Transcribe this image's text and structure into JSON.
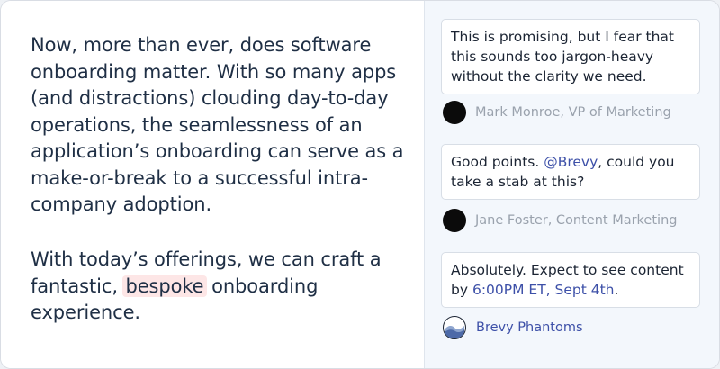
{
  "document": {
    "paragraph1": "Now, more than ever, does software onboarding matter. With so many apps (and distractions) clouding day-to-day operations, the seamlessness of an application’s onboarding can serve as a make-or-break to a successful intra-company adoption.",
    "paragraph2_before": "With today’s offerings, we can craft a fantastic, ",
    "paragraph2_highlight": "bespoke",
    "paragraph2_after": " onboarding experience."
  },
  "comments": [
    {
      "text": "This is promising, but I fear that this sounds too jargon-heavy without the clarity we need.",
      "author": "Mark Monroe, VP of Marketing"
    },
    {
      "text_before": "Good points. ",
      "mention": "@Brevy",
      "text_after": ", could you take a stab at this?",
      "author": "Jane Foster, Content Marketing"
    },
    {
      "text_before": "Absolutely. Expect to see content by ",
      "mention": "6:00PM ET, Sept 4th",
      "text_after": ".",
      "author": "Brevy Phantoms"
    }
  ],
  "colors": {
    "text": "#1f2f45",
    "highlight": "#fde6e6",
    "accent": "#3d50a8",
    "sidebar_bg": "#f3f7fc",
    "muted": "#9aa2ad"
  }
}
